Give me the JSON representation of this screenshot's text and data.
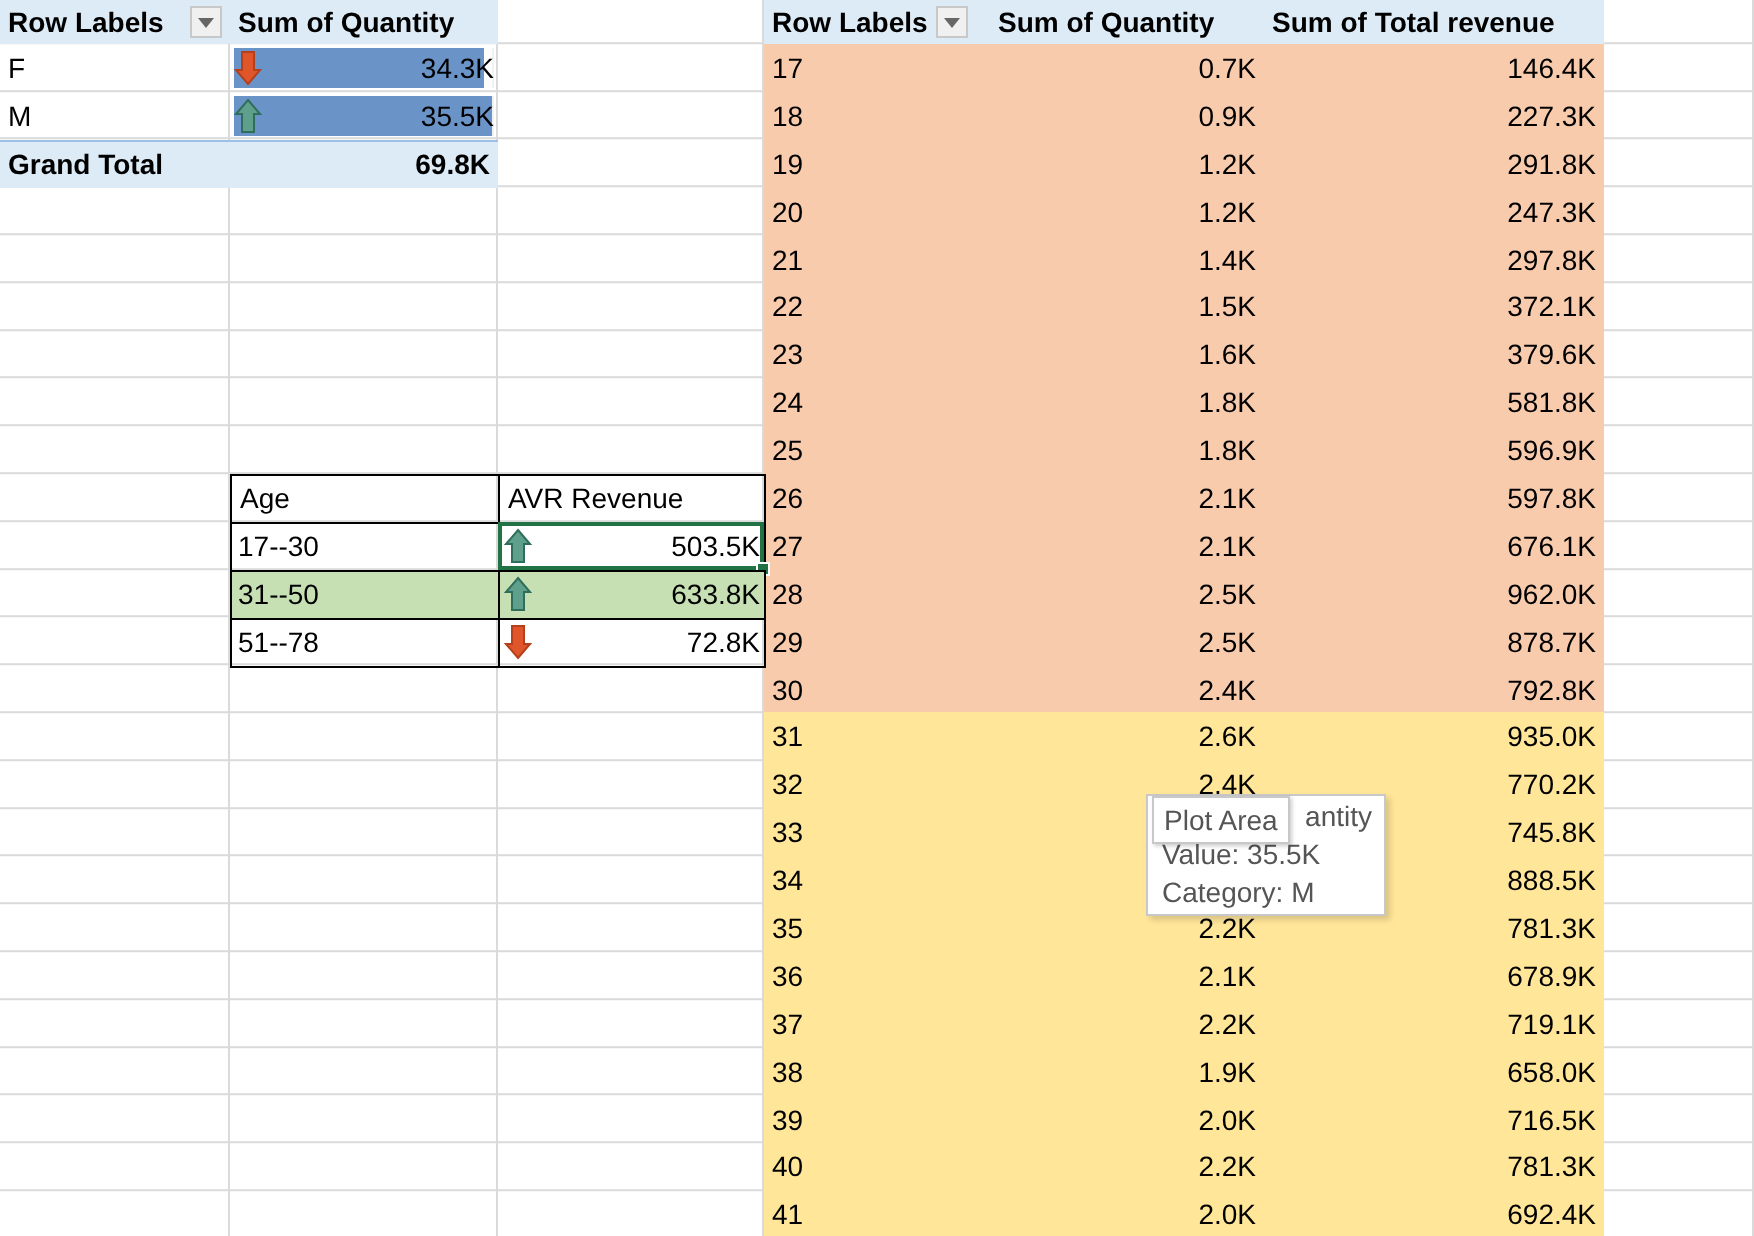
{
  "gender_pivot": {
    "columns": [
      "Row Labels",
      "Sum of Quantity"
    ],
    "rows": [
      {
        "label": "F",
        "kind": "down",
        "value": "34.3K",
        "level": 0.97
      },
      {
        "label": "M",
        "kind": "up",
        "value": "35.5K",
        "level": 1
      }
    ],
    "total": {
      "label": "Grand Total",
      "value": "69.8K"
    }
  },
  "age_table": {
    "columns": [
      "Age",
      "AVR Revenue"
    ],
    "rows": [
      {
        "age": "17--30",
        "kind": "up",
        "value": "503.5K",
        "selected": true,
        "highlighted": false
      },
      {
        "age": "31--50",
        "kind": "up",
        "value": "633.8K",
        "selected": false,
        "highlighted": true
      },
      {
        "age": "51--78",
        "kind": "down",
        "value": "72.8K",
        "selected": false,
        "highlighted": false
      }
    ]
  },
  "age_pivot": {
    "columns": [
      "Row Labels",
      "Sum of Quantity",
      "Sum of Total revenue"
    ],
    "rows": [
      {
        "label": "17",
        "quantity": "0.7K",
        "revenue": "146.4K",
        "color": "#f8cbad"
      },
      {
        "label": "18",
        "quantity": "0.9K",
        "revenue": "227.3K",
        "color": "#f8cbad"
      },
      {
        "label": "19",
        "quantity": "1.2K",
        "revenue": "291.8K",
        "color": "#f8cbad"
      },
      {
        "label": "20",
        "quantity": "1.2K",
        "revenue": "247.3K",
        "color": "#f8cbad"
      },
      {
        "label": "21",
        "quantity": "1.4K",
        "revenue": "297.8K",
        "color": "#f8cbad"
      },
      {
        "label": "22",
        "quantity": "1.5K",
        "revenue": "372.1K",
        "color": "#f8cbad"
      },
      {
        "label": "23",
        "quantity": "1.6K",
        "revenue": "379.6K",
        "color": "#f8cbad"
      },
      {
        "label": "24",
        "quantity": "1.8K",
        "revenue": "581.8K",
        "color": "#f8cbad"
      },
      {
        "label": "25",
        "quantity": "1.8K",
        "revenue": "596.9K",
        "color": "#f8cbad"
      },
      {
        "label": "26",
        "quantity": "2.1K",
        "revenue": "597.8K",
        "color": "#f8cbad"
      },
      {
        "label": "27",
        "quantity": "2.1K",
        "revenue": "676.1K",
        "color": "#f8cbad"
      },
      {
        "label": "28",
        "quantity": "2.5K",
        "revenue": "962.0K",
        "color": "#f8cbad"
      },
      {
        "label": "29",
        "quantity": "2.5K",
        "revenue": "878.7K",
        "color": "#f8cbad"
      },
      {
        "label": "30",
        "quantity": "2.4K",
        "revenue": "792.8K",
        "color": "#f8cbad"
      },
      {
        "label": "31",
        "quantity": "2.6K",
        "revenue": "935.0K",
        "color": "#ffe699"
      },
      {
        "label": "32",
        "quantity": "2.4K",
        "revenue": "770.2K",
        "color": "#ffe699"
      },
      {
        "label": "33",
        "revenue": "745.8K",
        "color": "#ffe699"
      },
      {
        "label": "34",
        "revenue": "888.5K",
        "color": "#ffe699"
      },
      {
        "label": "35",
        "quantity": "2.2K",
        "revenue": "781.3K",
        "color": "#ffe699"
      },
      {
        "label": "36",
        "quantity": "2.1K",
        "revenue": "678.9K",
        "color": "#ffe699"
      },
      {
        "label": "37",
        "quantity": "2.2K",
        "revenue": "719.1K",
        "color": "#ffe699"
      },
      {
        "label": "38",
        "quantity": "1.9K",
        "revenue": "658.0K",
        "color": "#ffe699"
      },
      {
        "label": "39",
        "quantity": "2.0K",
        "revenue": "716.5K",
        "color": "#ffe699"
      },
      {
        "label": "40",
        "quantity": "2.2K",
        "revenue": "781.3K",
        "color": "#ffe699"
      },
      {
        "label": "41",
        "quantity": "2.0K",
        "revenue": "692.4K",
        "color": "#ffe699"
      }
    ]
  },
  "tooltip": {
    "label": "Plot Area",
    "lines": [
      "antity",
      "Value: 35.5K",
      "Category: M"
    ]
  }
}
